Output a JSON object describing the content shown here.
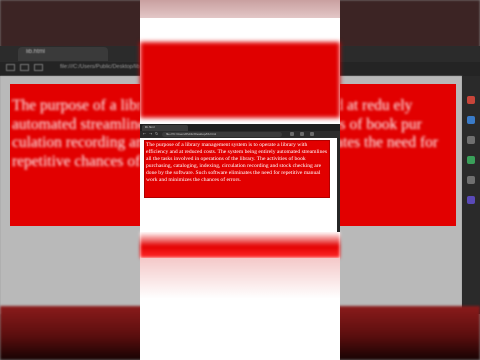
{
  "background": {
    "tab_label": "lib.html",
    "address": "file:///C:/Users/Public/Desktop/lib.html",
    "paragraph_visible": "The purpose of a libr                              ate a library with efficiency and at redu                              ely automated streamlines all the tas                              ibrary. The activities of book pur                              culation recording and stock checking a                              ware eliminates the need for repetitive                              chances of errors."
  },
  "window": {
    "tab_label": "lib.html",
    "url": "file:///C:/Users/Public/Desktop/lib.html",
    "nav_back": "←",
    "nav_forward": "→",
    "nav_reload": "↻"
  },
  "content": {
    "paragraph": "The purpose of a library management system is to operate a library with efficiency and at reduced costs. The system being entirely automated streamlines all the tasks involved in operations of the library. The activities of book purchasing, cataloging, indexing, circulation recording and stock checking are done by the software. Such software eliminates the need for repetitive manual work and minimizes the chances of errors."
  },
  "colors": {
    "highlight_red": "#e20000",
    "text_white": "#ffffff",
    "browser_dark": "#1f1f1f"
  }
}
